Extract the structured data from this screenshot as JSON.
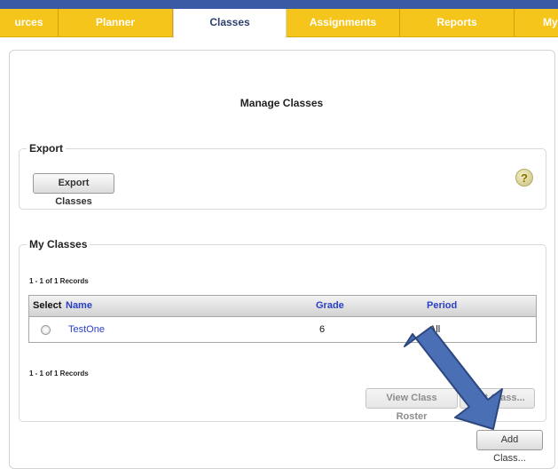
{
  "nav": {
    "tabs": [
      {
        "label": "urces",
        "active": false
      },
      {
        "label": "Planner",
        "active": false
      },
      {
        "label": "Classes",
        "active": true
      },
      {
        "label": "Assignments",
        "active": false
      },
      {
        "label": "Reports",
        "active": false
      },
      {
        "label": "My",
        "active": false
      }
    ]
  },
  "page": {
    "title": "Manage Classes"
  },
  "export": {
    "legend": "Export",
    "button_label": "Export Classes",
    "help_icon": "question-mark-icon",
    "help_glyph": "?"
  },
  "my_classes": {
    "legend": "My Classes",
    "records_top": "1 - 1 of 1 Records",
    "records_bottom": "1 - 1 of 1 Records",
    "columns": {
      "select": "Select",
      "name": "Name",
      "grade": "Grade",
      "period": "Period"
    },
    "rows": [
      {
        "name": "TestOne",
        "grade": "6",
        "period": "All",
        "selected": false
      }
    ],
    "view_roster_label": "View Class Roster",
    "edit_class_label": "Edit Class..."
  },
  "add_class_label": "Add Class...",
  "colors": {
    "nav_bar": "#f6c51b",
    "top_strip": "#3a5aa6",
    "link": "#2a3fc4",
    "arrow": "#4a6fb5"
  }
}
